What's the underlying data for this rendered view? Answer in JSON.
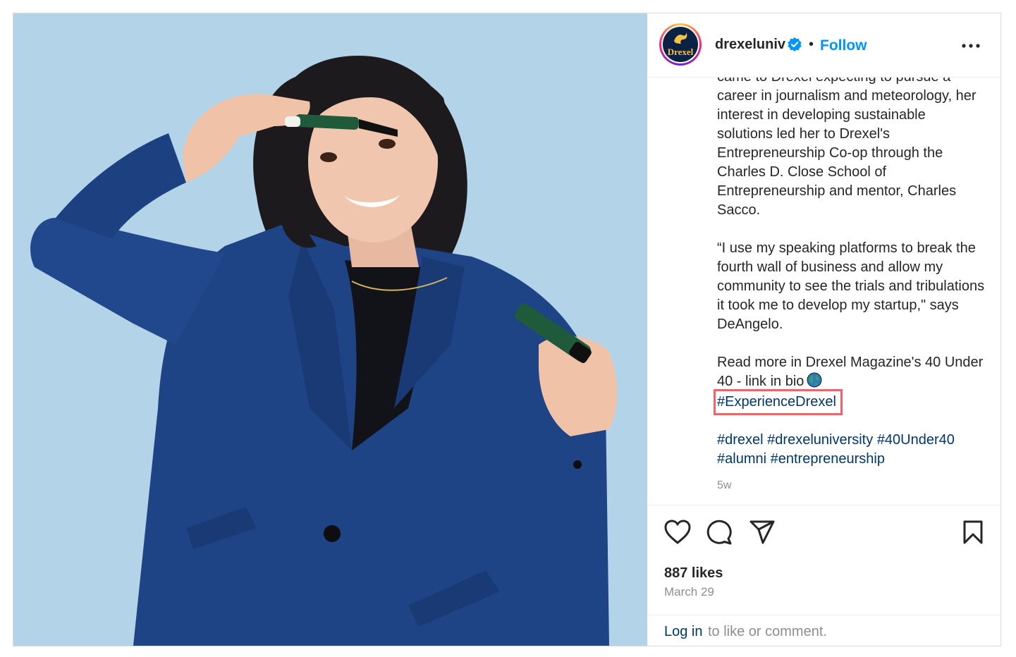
{
  "header": {
    "username": "drexeluniv",
    "separator": "•",
    "follow_label": "Follow",
    "avatar_text": "Drexel"
  },
  "caption": {
    "para1": "came to Drexel expecting to pursue a career in journalism and meteorology, her interest in developing sustainable solutions led her to Drexel's Entrepreneurship Co-op through the Charles D. Close School of Entrepreneurship and mentor, Charles Sacco.",
    "para2": "“I use my speaking platforms to break the fourth wall of business and allow my community to see the trials and tribulations it took me to develop my startup,\" says DeAngelo.",
    "para3": "Read more in Drexel Magazine's 40 Under 40 - link in bio",
    "highlight_tag": "#ExperienceDrexel",
    "tags": [
      "#drexel",
      "#drexeluniversity",
      "#40Under40",
      "#alumni",
      "#entrepreneurship"
    ],
    "age": "5w"
  },
  "footer": {
    "likes": "887 likes",
    "date": "March 29",
    "login_link": "Log in",
    "login_rest": "to like or comment."
  },
  "icons": [
    "verified-badge-icon",
    "more-options-icon",
    "heart-icon",
    "comment-icon",
    "share-icon",
    "bookmark-icon",
    "globe-emoji-icon"
  ],
  "colors": {
    "accent": "#0095f6",
    "link": "#00376b",
    "highlight_box": "#e6686a",
    "photo_bg": "#b3d4e8",
    "blazer": "#1f4486"
  }
}
